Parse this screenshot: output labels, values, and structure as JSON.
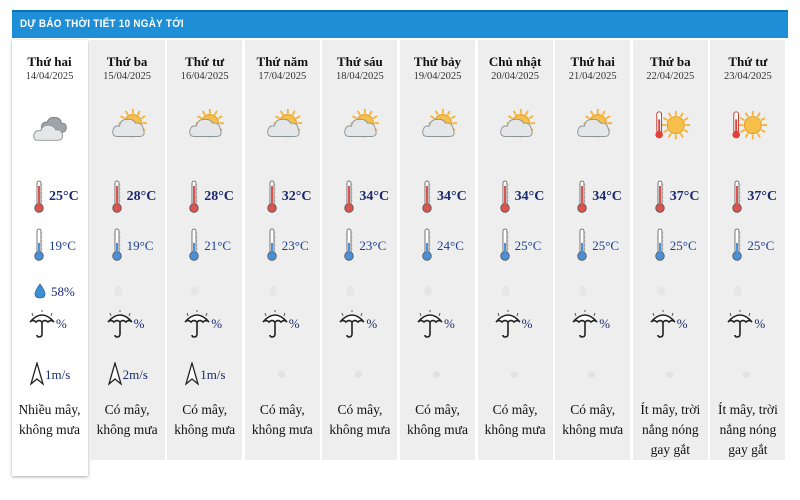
{
  "header": {
    "title": "DỰ BÁO THỜI TIẾT 10 NGÀY TỚI"
  },
  "days": [
    {
      "name": "Thứ hai",
      "date": "14/04/2025",
      "icon": "cloudy-icon",
      "high": "25°C",
      "low": "19°C",
      "humidity": "58%",
      "rain": "%",
      "wind": "1m/s",
      "desc": [
        "Nhiều mây,",
        "không mưa"
      ]
    },
    {
      "name": "Thứ ba",
      "date": "15/04/2025",
      "icon": "partly-cloudy-icon",
      "high": "28°C",
      "low": "19°C",
      "humidity": "",
      "rain": "%",
      "wind": "2m/s",
      "desc": [
        "Có mây,",
        "không mưa"
      ]
    },
    {
      "name": "Thứ tư",
      "date": "16/04/2025",
      "icon": "partly-cloudy-icon",
      "high": "28°C",
      "low": "21°C",
      "humidity": "",
      "rain": "%",
      "wind": "1m/s",
      "desc": [
        "Có mây,",
        "không mưa"
      ]
    },
    {
      "name": "Thứ năm",
      "date": "17/04/2025",
      "icon": "partly-cloudy-icon",
      "high": "32°C",
      "low": "23°C",
      "humidity": "",
      "rain": "%",
      "wind": "",
      "desc": [
        "Có mây,",
        "không mưa"
      ]
    },
    {
      "name": "Thứ sáu",
      "date": "18/04/2025",
      "icon": "partly-cloudy-icon",
      "high": "34°C",
      "low": "23°C",
      "humidity": "",
      "rain": "%",
      "wind": "",
      "desc": [
        "Có mây,",
        "không mưa"
      ]
    },
    {
      "name": "Thứ bảy",
      "date": "19/04/2025",
      "icon": "partly-cloudy-icon",
      "high": "34°C",
      "low": "24°C",
      "humidity": "",
      "rain": "%",
      "wind": "",
      "desc": [
        "Có mây,",
        "không mưa"
      ]
    },
    {
      "name": "Chủ nhật",
      "date": "20/04/2025",
      "icon": "partly-cloudy-icon",
      "high": "34°C",
      "low": "25°C",
      "humidity": "",
      "rain": "%",
      "wind": "",
      "desc": [
        "Có mây,",
        "không mưa"
      ]
    },
    {
      "name": "Thứ hai",
      "date": "21/04/2025",
      "icon": "partly-cloudy-icon",
      "high": "34°C",
      "low": "25°C",
      "humidity": "",
      "rain": "%",
      "wind": "",
      "desc": [
        "Có mây,",
        "không mưa"
      ]
    },
    {
      "name": "Thứ ba",
      "date": "22/04/2025",
      "icon": "hot-sun-icon",
      "high": "37°C",
      "low": "25°C",
      "humidity": "",
      "rain": "%",
      "wind": "",
      "desc": [
        "Ít mây, trời",
        "nắng nóng",
        "gay gắt"
      ]
    },
    {
      "name": "Thứ tư",
      "date": "23/04/2025",
      "icon": "hot-sun-icon",
      "high": "37°C",
      "low": "25°C",
      "humidity": "",
      "rain": "%",
      "wind": "",
      "desc": [
        "Ít mây, trời",
        "nắng nóng",
        "gay gắt"
      ]
    }
  ],
  "colors": {
    "header_bg": "#1e8fd6",
    "temp_text": "#1a2a6e",
    "thermometer_hot": "#d9534f",
    "thermometer_cool": "#4a90d9",
    "sun": "#f6b53a"
  }
}
